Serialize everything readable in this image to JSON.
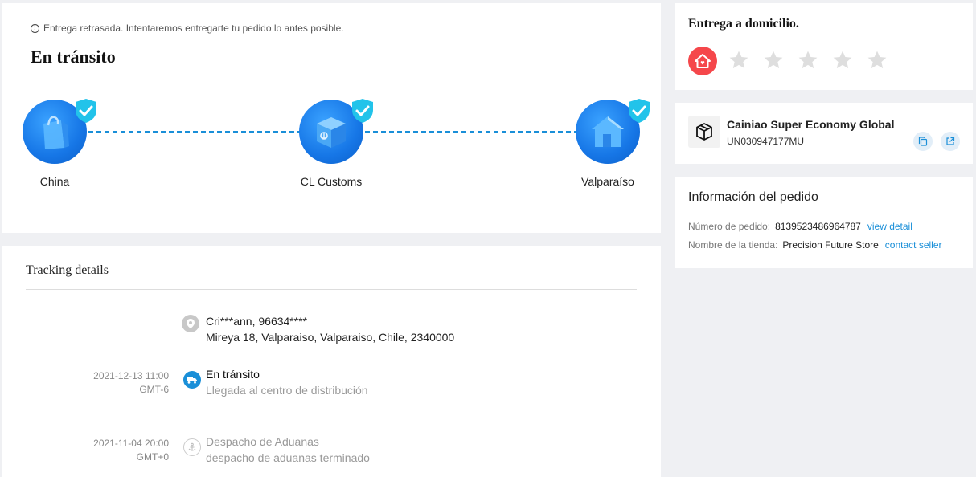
{
  "status": {
    "delay_notice": "Entrega retrasada. Intentaremos entregarte tu pedido lo antes posible.",
    "title": "En tránsito",
    "route": [
      {
        "label": "China",
        "icon": "shopping-bag-icon"
      },
      {
        "label": "CL Customs",
        "icon": "customs-box-icon"
      },
      {
        "label": "Valparaíso",
        "icon": "house-icon"
      }
    ],
    "accent_color": "#1a8fd8"
  },
  "tracking": {
    "title": "Tracking details",
    "address": {
      "line1": "Cri***ann,  96634****",
      "line2": "Mireya 18,  Valparaiso,  Valparaiso,  Chile,  2340000"
    },
    "events": [
      {
        "date": "2021-12-13 11:00",
        "tz": "GMT-6",
        "title": "En tránsito",
        "detail": "Llegada al centro de distribución"
      },
      {
        "date": "2021-11-04 20:00",
        "tz": "GMT+0",
        "title": "Despacho de Aduanas",
        "detail": "despacho de aduanas terminado"
      }
    ]
  },
  "delivery": {
    "title": "Entrega a domicilio.",
    "rating": 0,
    "max_rating": 5,
    "badge_color": "#f5474b"
  },
  "carrier": {
    "name": "Cainiao Super Economy Global",
    "tracking_number": "UN030947177MU"
  },
  "order": {
    "title": "Información del pedido",
    "number_label": "Número de pedido:",
    "number_value": "8139523486964787",
    "number_link": "view detail",
    "store_label": "Nombre de la tienda:",
    "store_value": "Precision Future Store",
    "store_link": "contact seller"
  }
}
